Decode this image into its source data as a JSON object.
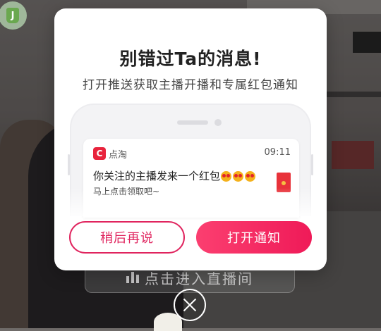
{
  "modal": {
    "title": "别错过Ta的消息!",
    "subtitle": "打开推送获取主播开播和专属红包通知",
    "notification": {
      "app_icon_letter": "C",
      "app_name": "点淘",
      "time": "09:11",
      "message": "你关注的主播发来一个红包",
      "sub_message": "马上点击领取吧~",
      "emoji_count": 3
    },
    "later_button": "稍后再说",
    "open_button": "打开通知"
  },
  "background": {
    "avatar_icon_text": "J",
    "enter_room_button": "点击进入直播间"
  },
  "colors": {
    "accent": "#ef1a58",
    "accent_light": "#fb3f70",
    "outline": "#e0245e"
  },
  "icons": {
    "close": "close-icon",
    "app": "diantao-app-icon",
    "envelope": "red-envelope-icon",
    "live_bars": "live-bars-icon"
  }
}
